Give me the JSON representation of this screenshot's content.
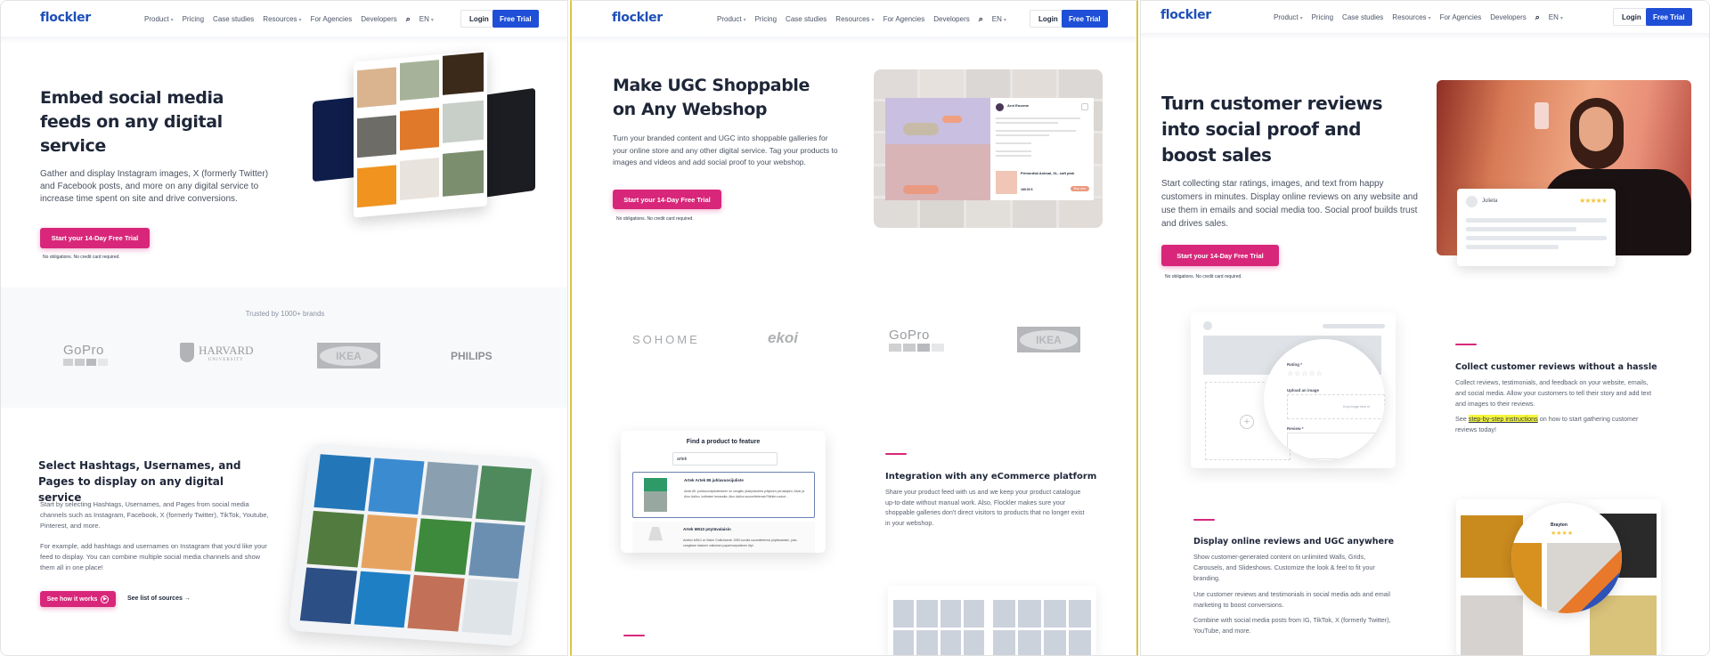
{
  "nav": {
    "logo": "flockler",
    "items": [
      "Product",
      "Pricing",
      "Case studies",
      "Resources",
      "For Agencies",
      "Developers"
    ],
    "language": "EN",
    "login": "Login",
    "free_trial": "Free Trial"
  },
  "panel1": {
    "hero_title_lines": [
      "Embed social media",
      "feeds on any digital",
      "service"
    ],
    "hero_lead": "Gather and display Instagram images, X (formerly Twitter) and Facebook posts, and more on any digital service to increase time spent on site and drive conversions.",
    "cta": "Start your 14-Day Free Trial",
    "fine_print": "No obligations. No credit card required.",
    "trusted_label": "Trusted by 1000+ brands",
    "brands": [
      "GoPro",
      "HARVARD",
      "UNIVERSITY",
      "IKEA",
      "PHILIPS"
    ],
    "section_title": "Select Hashtags, Usernames, and Pages to display on any digital service",
    "section_p1": "Start by selecting Hashtags, Usernames, and Pages from social media channels such as Instagram, Facebook, X (formerly Twitter), TikTok, Youtube, Pinterest, and more.",
    "section_p2": "For example, add hashtags and usernames on Instagram that you'd like your feed to display. You can combine multiple social media channels and show them all in one place!",
    "see_how": "See how it works",
    "see_sources": "See list of sources →"
  },
  "panel2": {
    "hero_title_lines": [
      "Make UGC Shoppable",
      "on Any Webshop"
    ],
    "hero_lead": "Turn your branded content and UGC into shoppable galleries for your online store and any other digital service. Tag your products to images and videos and add social proof to your webshop.",
    "cta": "Start your 14-Day Free Trial",
    "fine_print": "No obligations. No credit card required.",
    "brands": [
      "SOHOME",
      "ekoi",
      "GoPro",
      "IKEA"
    ],
    "product_card": {
      "author": "Arni Enorme",
      "product_name": "Primordial Animal, XL, soft pink",
      "price": "169.00 €",
      "buy": "Buy now"
    },
    "finder": {
      "title": "Find a product to feature",
      "query": "artek",
      "results": [
        {
          "name": "Artek Artek 85 juhlavuosijuliste",
          "desc": "Artek 85 -juhlavuosijulisteeseen on vangittu yksityiskohtia yrityksen perustajien, Alvar ja Aino Aallon, kotikaleri tenasalta. Aino Aallon suunnittelemat Rikhtie-ruukut..."
        },
        {
          "name": "Artek M510 pöytävalaisin",
          "desc": "Artekin M510 on Maire Gullichsenin 1950-luvulla suunnittelema pöytävalaisin, joka vangitsee kaiseen valkoisen paperivarjostimen läpi"
        }
      ]
    },
    "feature_title": "Integration with any eCommerce platform",
    "feature_body": "Share your product feed with us and we keep your product catalogue up-to-date without manual work. Also, Flockler makes sure your shoppable galleries don't direct visitors to products that no longer exist in your webshop."
  },
  "panel3": {
    "hero_title_lines": [
      "Turn customer reviews",
      "into social proof and",
      "boost sales"
    ],
    "hero_lead": "Start collecting star ratings, images, and text from happy customers in minutes. Display online reviews on any website and use them in emails and social media too. Social proof builds trust and drives sales.",
    "cta": "Start your 14-Day Free Trial",
    "fine_print": "No obligations. No credit card required.",
    "review_card": {
      "name": "Julieta",
      "stars": 5
    },
    "form": {
      "rating_label": "Rating *",
      "upload_label": "Upload an image",
      "drop_text": "Drop image here or",
      "review_label": "Review *"
    },
    "collect_title": "Collect customer reviews without a hassle",
    "collect_body": "Collect reviews, testimonials, and feedback on your website, emails, and social media. Allow your customers to tell their story and add text and images to their reviews.",
    "collect_see": "See",
    "collect_link": "step-by-step instructions",
    "collect_tail": "on how to start gathering customer reviews today!",
    "display_title": "Display online reviews and UGC anywhere",
    "display_p1": "Show customer-generated content on unlimited Walls, Grids, Carousels, and Slideshows. Customize the look & feel to fit your branding.",
    "display_p2": "Use customer reviews and testimonials in social media ads and email marketing to boost conversions.",
    "display_p3": "Combine with social media posts from IG, TikTok, X (formerly Twitter), YouTube, and more.",
    "grid_reviewer": "Brayton",
    "grid_reviewer_stars": 4
  },
  "colors": {
    "brand_blue": "#1e4fd6",
    "cta_pink": "#d8277a",
    "heading": "#1e2638",
    "highlight": "#f6f63a"
  }
}
